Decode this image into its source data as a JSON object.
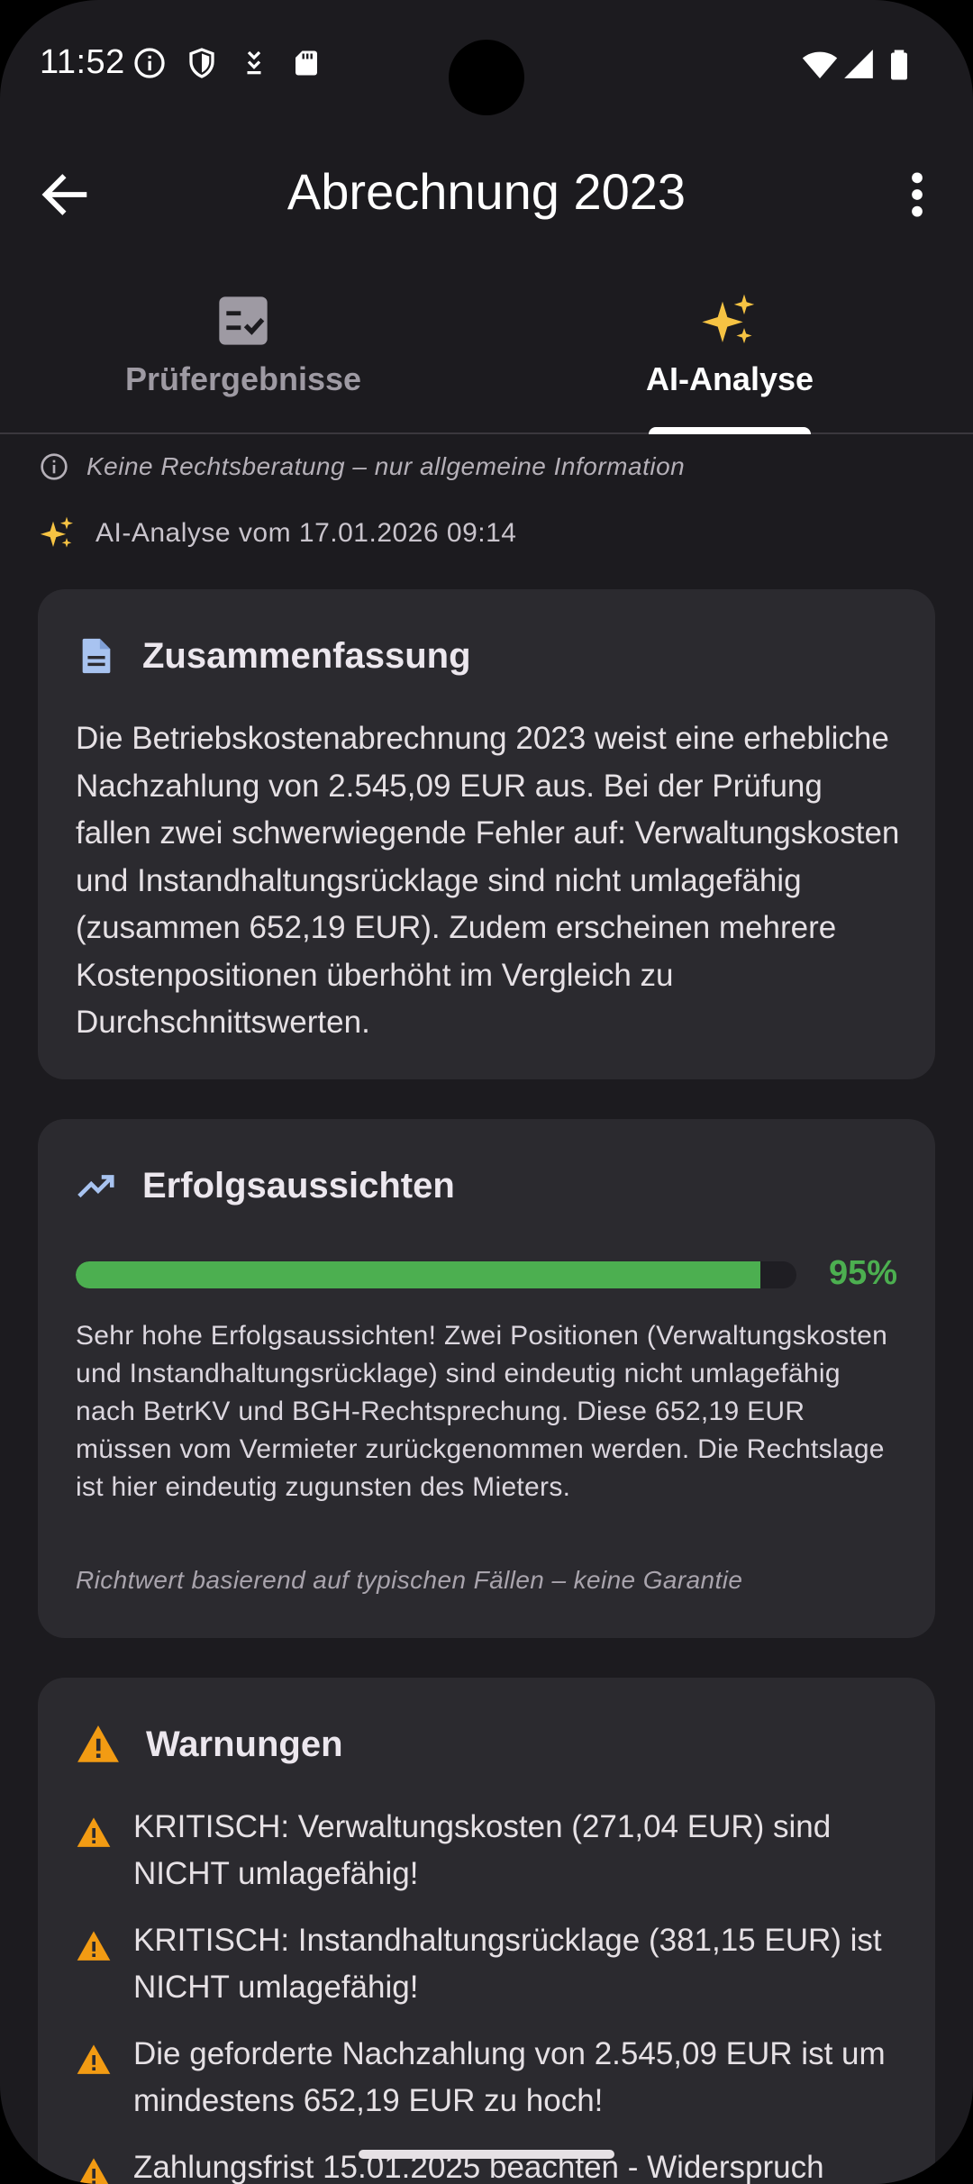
{
  "status_bar": {
    "time": "11:52",
    "left_icons": [
      "info-icon",
      "shield-icon",
      "download-icon",
      "sd-card-icon"
    ],
    "right_icons": [
      "wifi-icon",
      "signal-icon",
      "battery-icon"
    ]
  },
  "app_bar": {
    "title": "Abrechnung 2023",
    "back_icon": "arrow-back-icon",
    "menu_icon": "more-vert-icon"
  },
  "tabs": [
    {
      "label": "Prüfergebnisse",
      "icon": "checklist-icon",
      "active": false
    },
    {
      "label": "AI-Analyse",
      "icon": "sparkle-icon",
      "active": true
    }
  ],
  "disclaimer": "Keine Rechtsberatung – nur allgemeine Information",
  "analysis_date": "AI-Analyse vom 17.01.2026 09:14",
  "summary": {
    "heading": "Zusammenfassung",
    "text": "Die Betriebskostenabrechnung 2023 weist eine erhebliche Nachzahlung von 2.545,09 EUR aus. Bei der Prüfung fallen zwei schwerwiegende Fehler auf: Verwaltungskosten und Instandhaltungsrücklage sind nicht umlagefähig (zusammen 652,19 EUR). Zudem erscheinen mehrere Kostenpositionen überhöht im Vergleich zu Durchschnittswerten."
  },
  "success": {
    "heading": "Erfolgsaussichten",
    "percent": 95,
    "percent_label": "95%",
    "text": "Sehr hohe Erfolgsaussichten! Zwei Positionen (Verwaltungskosten und Instandhaltungsrücklage) sind eindeutig nicht umlagefähig nach BetrKV und BGH-Rechtsprechung. Diese 652,19 EUR müssen vom Vermieter zurückgenommen werden. Die Rechtslage ist hier eindeutig zugunsten des Mieters.",
    "note": "Richtwert basierend auf typischen Fällen – keine Garantie"
  },
  "warnings": {
    "heading": "Warnungen",
    "items": [
      "KRITISCH: Verwaltungskosten (271,04 EUR) sind NICHT umlagefähig!",
      "KRITISCH: Instandhaltungsrücklage (381,15 EUR) ist NICHT umlagefähig!",
      "Die geforderte Nachzahlung von 2.545,09 EUR ist um mindestens 652,19 EUR zu hoch!",
      "Zahlungsfrist 15.01.2025 beachten - Widerspruch"
    ]
  },
  "colors": {
    "background": "#1c1b1f",
    "card": "#2b2a2f",
    "accent_yellow": "#f6c343",
    "warning_orange": "#f29b13",
    "success_green": "#4caf50",
    "summary_icon_blue": "#a8c3f0"
  }
}
